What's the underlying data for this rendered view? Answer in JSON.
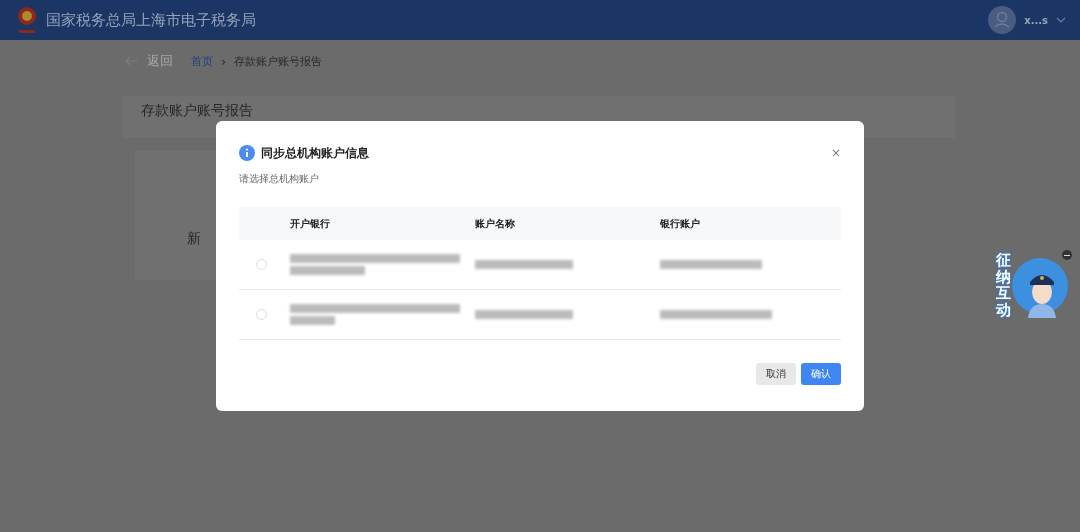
{
  "header": {
    "title": "国家税务总局上海市电子税务局",
    "user": "x...s"
  },
  "breadcrumb": {
    "back": "返回",
    "items": [
      {
        "label": "首页",
        "kind": "link"
      },
      {
        "label": "存款账户账号报告",
        "kind": "current"
      }
    ],
    "separator": "›"
  },
  "page": {
    "card_title": "存款账户账号报告",
    "card_text": "新"
  },
  "dialog": {
    "title": "同步总机构账户信息",
    "close": "×",
    "prompt": "请选择总机构账户",
    "columns": [
      "开户银行",
      "账户名称",
      "银行账户"
    ],
    "rows": [
      {
        "selected": false
      },
      {
        "selected": false
      }
    ],
    "buttons": [
      {
        "label": "取消",
        "kind": "secondary"
      },
      {
        "label": "确认",
        "kind": "primary"
      }
    ]
  },
  "assistant": {
    "label": "征纳互动"
  }
}
